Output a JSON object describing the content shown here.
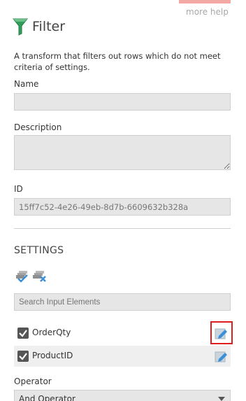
{
  "help_link": "more help",
  "header": {
    "title": "Filter",
    "icon": "filter-funnel-icon"
  },
  "description_text": "A transform that filters out rows which do not meet criteria of settings.",
  "fields": {
    "name": {
      "label": "Name",
      "value": ""
    },
    "description": {
      "label": "Description",
      "value": ""
    },
    "id": {
      "label": "ID",
      "value": "15ff7c52-4e26-49eb-8d7b-6609632b328a"
    }
  },
  "settings": {
    "title": "SETTINGS",
    "toolbar": {
      "select_all_icon": "select-all-icon",
      "clear_all_icon": "clear-all-icon"
    },
    "search": {
      "placeholder": "Search Input Elements"
    },
    "elements": [
      {
        "label": "OrderQty",
        "checked": true,
        "highlighted": true
      },
      {
        "label": "ProductID",
        "checked": true,
        "highlighted": false
      }
    ],
    "operator": {
      "label": "Operator",
      "value": "And Operator"
    }
  },
  "colors": {
    "accent": "#f4a7a3",
    "highlight": "#e01e1e",
    "icon_blue": "#3a8fd8",
    "funnel_green": "#2e9e5a"
  }
}
